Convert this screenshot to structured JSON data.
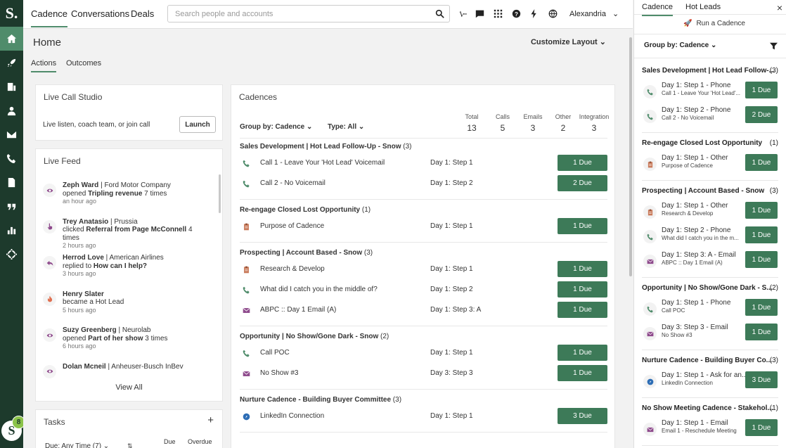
{
  "nav": {
    "logo": "S.",
    "badge": "8",
    "bottom_logo": "S"
  },
  "topbar": {
    "tabs": [
      "Cadence",
      "Conversations",
      "Deals"
    ],
    "search_placeholder": "Search people and accounts",
    "user": "Alexandria"
  },
  "home": {
    "title": "Home",
    "customize": "Customize Layout",
    "subtabs": [
      "Actions",
      "Outcomes"
    ]
  },
  "live_call": {
    "title": "Live Call Studio",
    "desc": "Live listen, coach team, or join call",
    "launch": "Launch"
  },
  "live_feed": {
    "title": "Live Feed",
    "items": [
      {
        "name": "Zeph Ward",
        "company": " | Ford Motor Company",
        "verb": "opened ",
        "object": "Tripling revenue",
        "suffix": " 7 times",
        "time": "an hour ago",
        "icon": "eye-icon"
      },
      {
        "name": "Trey Anatasio",
        "company": " | Prussia",
        "verb": "clicked ",
        "object": "Referral from Page McConnell",
        "suffix": " 4 times",
        "time": "2 hours ago",
        "icon": "pointer-icon"
      },
      {
        "name": "Herrod Love",
        "company": " | American Airlines",
        "verb": "replied to ",
        "object": "How can I help?",
        "suffix": "",
        "time": "3 hours ago",
        "icon": "reply-icon"
      },
      {
        "name": "Henry Slater",
        "company": "",
        "verb": "became a Hot Lead",
        "object": "",
        "suffix": "",
        "time": "5 hours ago",
        "icon": "flame-icon"
      },
      {
        "name": "Suzy Greenberg",
        "company": " | Neurolab",
        "verb": "opened ",
        "object": "Part of her show",
        "suffix": " 3 times",
        "time": "6 hours ago",
        "icon": "eye-icon"
      },
      {
        "name": "Dolan Mcneil",
        "company": " | Anheuser-Busch InBev",
        "verb": "",
        "object": "",
        "suffix": "",
        "time": "",
        "icon": "eye-icon"
      }
    ],
    "view_all": "View All"
  },
  "tasks": {
    "title": "Tasks",
    "add": "+",
    "due_filter": "Due: Any Time (7)",
    "col_due": "Due",
    "col_overdue": "Overdue"
  },
  "cadences": {
    "title": "Cadences",
    "group_by": "Group by: Cadence",
    "type": "Type: All",
    "stats": [
      {
        "label": "Total",
        "value": "13"
      },
      {
        "label": "Calls",
        "value": "5"
      },
      {
        "label": "Emails",
        "value": "3"
      },
      {
        "label": "Other",
        "value": "2"
      },
      {
        "label": "Integration",
        "value": "3"
      }
    ],
    "groups": [
      {
        "title": "Sales Development | Hot Lead Follow-Up - Snow",
        "count": " (3)",
        "steps": [
          {
            "name": "Call 1 - Leave Your 'Hot Lead' Voicemail",
            "day": "Day 1: Step 1",
            "due": "1 Due",
            "icon": "phone-icon"
          },
          {
            "name": "Call 2 - No Voicemail",
            "day": "Day 1: Step 2",
            "due": "2 Due",
            "icon": "phone-icon"
          }
        ]
      },
      {
        "title": "Re-engage Closed Lost Opportunity",
        "count": " (1)",
        "steps": [
          {
            "name": "Purpose of Cadence",
            "day": "Day 1: Step 1",
            "due": "1 Due",
            "icon": "clipboard-icon"
          }
        ]
      },
      {
        "title": "Prospecting | Account Based - Snow",
        "count": " (3)",
        "steps": [
          {
            "name": "Research & Develop",
            "day": "Day 1: Step 1",
            "due": "1 Due",
            "icon": "clipboard-icon"
          },
          {
            "name": "What did I catch you in the middle of?",
            "day": "Day 1: Step 2",
            "due": "1 Due",
            "icon": "phone-icon"
          },
          {
            "name": "ABPC :: Day 1 Email (A)",
            "day": "Day 1: Step 3: A",
            "due": "1 Due",
            "icon": "email-icon"
          }
        ]
      },
      {
        "title": "Opportunity | No Show/Gone Dark - Snow",
        "count": " (2)",
        "steps": [
          {
            "name": "Call POC",
            "day": "Day 1: Step 1",
            "due": "1 Due",
            "icon": "phone-icon"
          },
          {
            "name": "No Show #3",
            "day": "Day 3: Step 3",
            "due": "1 Due",
            "icon": "email-icon"
          }
        ]
      },
      {
        "title": "Nurture Cadence - Building Buyer Committee",
        "count": " (3)",
        "steps": [
          {
            "name": "LinkedIn Connection",
            "day": "Day 1: Step 1",
            "due": "3 Due",
            "icon": "linkedin-icon"
          }
        ]
      }
    ]
  },
  "right_panel": {
    "tabs": [
      "Cadence",
      "Hot Leads"
    ],
    "close": "×",
    "run": "Run a Cadence",
    "group_by": "Group by: Cadence",
    "groups": [
      {
        "title": "Sales Development | Hot Lead Follow-...",
        "count": "(3)",
        "items": [
          {
            "step": "Day 1: Step 1 - Phone",
            "sub": "Call 1 - Leave Your 'Hot Lead'...",
            "due": "1 Due",
            "icon": "phone-icon"
          },
          {
            "step": "Day 1: Step 2 - Phone",
            "sub": "Call 2 - No Voicemail",
            "due": "2 Due",
            "icon": "phone-icon"
          }
        ]
      },
      {
        "title": "Re-engage Closed Lost Opportunity",
        "count": "(1)",
        "items": [
          {
            "step": "Day 1: Step 1 - Other",
            "sub": "Purpose of Cadence",
            "due": "1 Due",
            "icon": "clipboard-icon"
          }
        ]
      },
      {
        "title": "Prospecting | Account Based - Snow",
        "count": "(3)",
        "items": [
          {
            "step": "Day 1: Step 1 - Other",
            "sub": "Research & Develop",
            "due": "1 Due",
            "icon": "clipboard-icon"
          },
          {
            "step": "Day 1: Step 2 - Phone",
            "sub": "What did I catch you in the m...",
            "due": "1 Due",
            "icon": "phone-icon"
          },
          {
            "step": "Day 1: Step 3: A - Email",
            "sub": "ABPC :: Day 1 Email (A)",
            "due": "1 Due",
            "icon": "email-icon"
          }
        ]
      },
      {
        "title": "Opportunity | No Show/Gone Dark - S...",
        "count": "(2)",
        "items": [
          {
            "step": "Day 1: Step 1 - Phone",
            "sub": "Call POC",
            "due": "1 Due",
            "icon": "phone-icon"
          },
          {
            "step": "Day 3: Step 3 - Email",
            "sub": "No Show #3",
            "due": "1 Due",
            "icon": "email-icon"
          }
        ]
      },
      {
        "title": "Nurture Cadence - Building Buyer Co...",
        "count": "(3)",
        "items": [
          {
            "step": "Day 1: Step 1 - Ask for an...",
            "sub": "LinkedIn Connection",
            "due": "3 Due",
            "icon": "linkedin-icon"
          }
        ]
      },
      {
        "title": "No Show Meeting Cadence - Stakehol...",
        "count": "(1)",
        "items": [
          {
            "step": "Day 1: Step 1 - Email",
            "sub": "Email 1 - Reschedule Meeting",
            "due": "1 Due",
            "icon": "email-icon"
          }
        ]
      }
    ]
  },
  "colors": {
    "brand_dark": "#1d3a2c",
    "accent": "#4f8c6b",
    "due_button": "#3d7a58"
  }
}
